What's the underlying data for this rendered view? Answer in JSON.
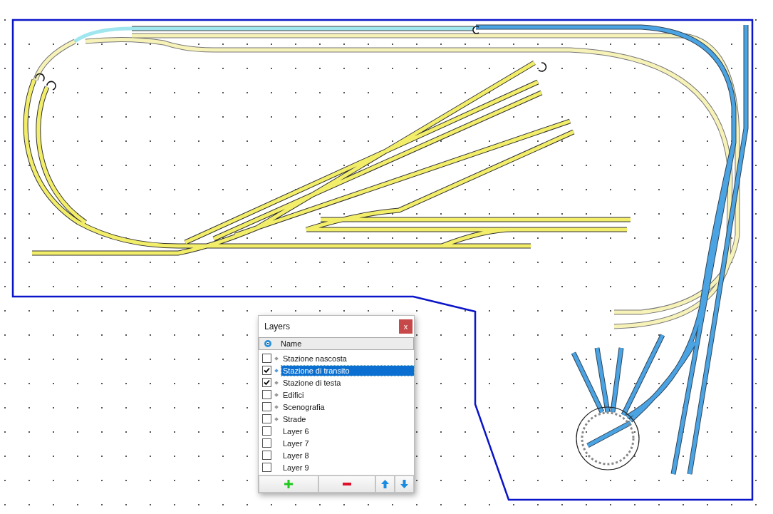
{
  "layers_panel": {
    "title": "Layers",
    "close_label": "x",
    "header": {
      "name_column": "Name"
    },
    "layers": [
      {
        "name": "Stazione nascosta",
        "checked": false,
        "selected": false,
        "has_content": true
      },
      {
        "name": "Stazione di transito",
        "checked": true,
        "selected": true,
        "has_content": true
      },
      {
        "name": "Stazione di testa",
        "checked": true,
        "selected": false,
        "has_content": true
      },
      {
        "name": "Edifici",
        "checked": false,
        "selected": false,
        "has_content": true
      },
      {
        "name": "Scenografia",
        "checked": false,
        "selected": false,
        "has_content": true
      },
      {
        "name": "Strade",
        "checked": false,
        "selected": false,
        "has_content": true
      },
      {
        "name": "Layer 6",
        "checked": false,
        "selected": false,
        "has_content": false
      },
      {
        "name": "Layer 7",
        "checked": false,
        "selected": false,
        "has_content": false
      },
      {
        "name": "Layer 8",
        "checked": false,
        "selected": false,
        "has_content": false
      },
      {
        "name": "Layer 9",
        "checked": false,
        "selected": false,
        "has_content": false
      }
    ],
    "buttons": [
      {
        "kind": "add"
      },
      {
        "kind": "remove"
      },
      {
        "kind": "up"
      },
      {
        "kind": "down"
      }
    ]
  }
}
